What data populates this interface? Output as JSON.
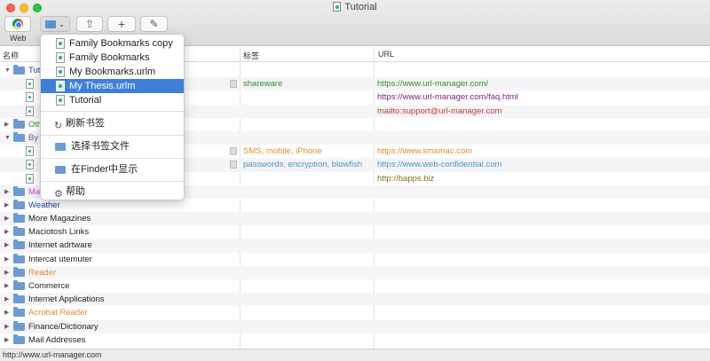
{
  "window": {
    "title": "Tutorial"
  },
  "toolbar": {
    "web_label": "Web",
    "share_glyph": "⇧",
    "add_glyph": "+",
    "edit_glyph": "✎"
  },
  "columns": {
    "name": "名称",
    "tags": "标签",
    "url": "URL"
  },
  "rows": [
    {
      "name": "Tut",
      "kind": "folder",
      "expanded": true,
      "tags": "",
      "url": "",
      "name_color": "#1f3fb0"
    },
    {
      "name": "",
      "kind": "bookmark",
      "tags": "shareware",
      "url": "https://www.url-manager.com/",
      "tags_color": "#2e8b2e",
      "url_color": "#2e8b2e"
    },
    {
      "name": "",
      "kind": "bookmark",
      "tags": "",
      "url": "https://www.url-manager.com/faq.html",
      "url_color": "#7a1f8f"
    },
    {
      "name": "",
      "kind": "bookmark",
      "tags": "",
      "url": "mailto:support@url-manager.com",
      "url_color": "#c0392b"
    },
    {
      "name": "Oth",
      "kind": "folder",
      "expanded": false,
      "tags": "",
      "url": "",
      "name_color": "#2e8b2e"
    },
    {
      "name": "By",
      "kind": "folder",
      "expanded": true,
      "tags": "",
      "url": "",
      "name_color": "#7a4a8f"
    },
    {
      "name": "",
      "kind": "bookmark",
      "tags": "SMS, mobile, iPhone",
      "url": "https://www.smsmac.com",
      "tags_color": "#e08a2a",
      "url_color": "#e08a2a"
    },
    {
      "name": "",
      "kind": "bookmark",
      "tags": "passwords, encryption, blowfish",
      "url": "https://www.web-confidential.com",
      "tags_color": "#4a90c8",
      "url_color": "#4a90c8"
    },
    {
      "name": "",
      "kind": "bookmark",
      "tags": "",
      "url": "http://bapps.biz",
      "url_color": "#8a6d1f"
    },
    {
      "name": "Ma",
      "kind": "folder",
      "expanded": false,
      "tags": "",
      "url": "",
      "name_color": "#c93fc9"
    },
    {
      "name": "Weather",
      "kind": "folder",
      "expanded": false,
      "tags": "",
      "url": "",
      "name_color": "#1f3fb0"
    },
    {
      "name": "More Magazines",
      "kind": "folder",
      "expanded": false,
      "tags": "",
      "url": "",
      "name_color": "#222222"
    },
    {
      "name": "Maciotosh Links",
      "kind": "folder",
      "expanded": false,
      "tags": "",
      "url": "",
      "name_color": "#222222"
    },
    {
      "name": "Internet adrtware",
      "kind": "folder",
      "expanded": false,
      "tags": "",
      "url": "",
      "name_color": "#222222"
    },
    {
      "name": "Intercat utemuter",
      "kind": "folder",
      "expanded": false,
      "tags": "",
      "url": "",
      "name_color": "#222222"
    },
    {
      "name": "Reader",
      "kind": "folder",
      "expanded": false,
      "tags": "",
      "url": "",
      "name_color": "#e08a2a"
    },
    {
      "name": "Commerce",
      "kind": "folder",
      "expanded": false,
      "tags": "",
      "url": "",
      "name_color": "#222222"
    },
    {
      "name": "Internet Applications",
      "kind": "folder",
      "expanded": false,
      "tags": "",
      "url": "",
      "name_color": "#222222"
    },
    {
      "name": "Acrobat Reader",
      "kind": "folder",
      "expanded": false,
      "tags": "",
      "url": "",
      "name_color": "#e08a2a"
    },
    {
      "name": "Finance/Dictionary",
      "kind": "folder",
      "expanded": false,
      "tags": "",
      "url": "",
      "name_color": "#222222"
    },
    {
      "name": "Mail Addresses",
      "kind": "folder",
      "expanded": false,
      "tags": "",
      "url": "",
      "name_color": "#222222"
    }
  ],
  "menu": {
    "files": [
      {
        "label": "Family Bookmarks copy",
        "selected": false
      },
      {
        "label": "Family Bookmarks",
        "selected": false
      },
      {
        "label": "My Bookmarks.urlm",
        "selected": false
      },
      {
        "label": "My Thesis.urlm",
        "selected": true
      },
      {
        "label": "Tutorial",
        "selected": false
      }
    ],
    "refresh": "刷新书签",
    "choose_file": "选择书签文件",
    "show_in_finder": "在Finder中显示",
    "help": "帮助"
  },
  "status": {
    "text": "http://www.url-manager.com"
  }
}
